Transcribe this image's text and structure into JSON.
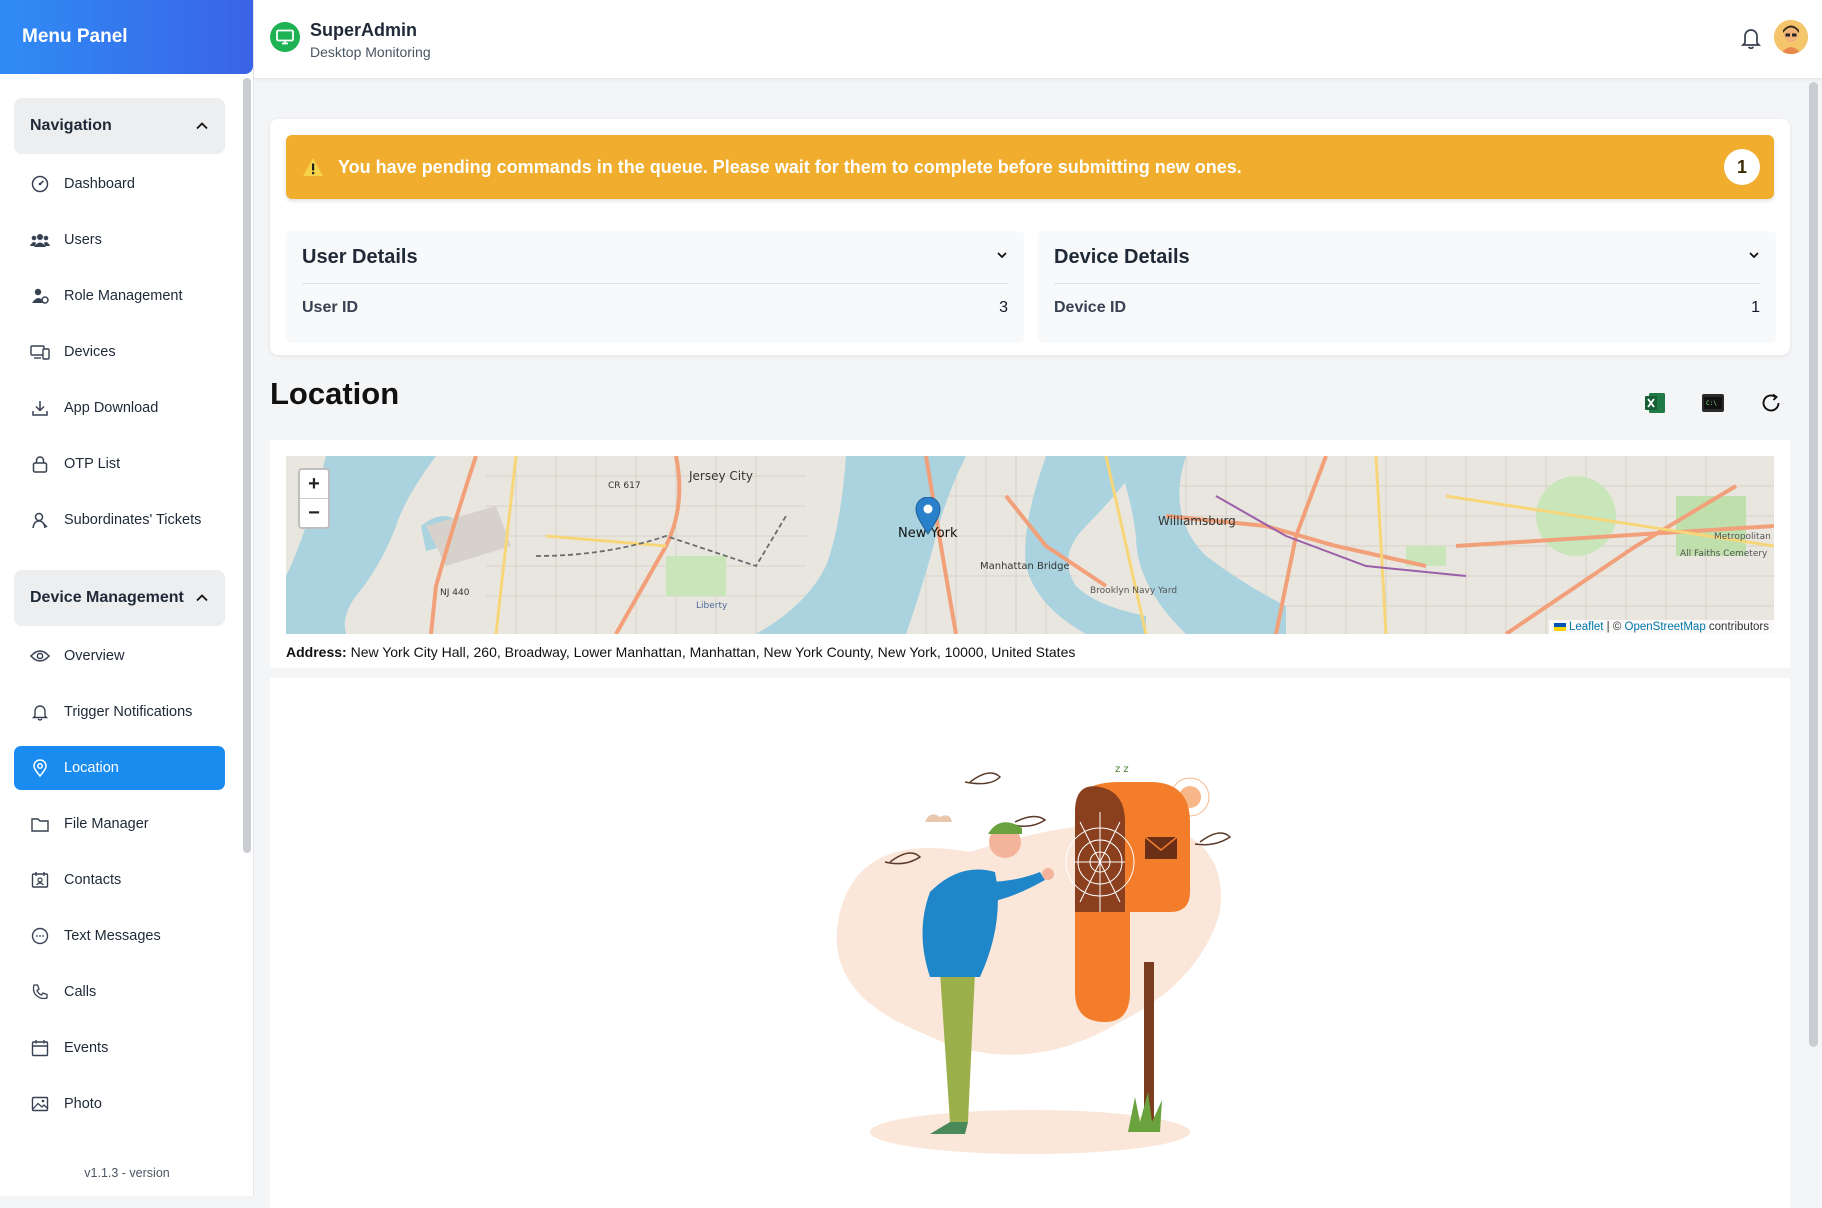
{
  "sidebar": {
    "title": "Menu Panel",
    "navigation": {
      "heading": "Navigation",
      "items": [
        {
          "label": "Dashboard",
          "icon": "dashboard-icon"
        },
        {
          "label": "Users",
          "icon": "users-icon"
        },
        {
          "label": "Role Management",
          "icon": "role-management-icon"
        },
        {
          "label": "Devices",
          "icon": "devices-icon"
        },
        {
          "label": "App Download",
          "icon": "download-icon"
        },
        {
          "label": "OTP List",
          "icon": "lock-icon"
        },
        {
          "label": "Subordinates' Tickets",
          "icon": "ticket-user-icon"
        }
      ]
    },
    "device_management": {
      "heading": "Device Management",
      "items": [
        {
          "label": "Overview",
          "icon": "eye-icon"
        },
        {
          "label": "Trigger Notifications",
          "icon": "bell-icon"
        },
        {
          "label": "Location",
          "icon": "location-pin-icon",
          "active": true
        },
        {
          "label": "File Manager",
          "icon": "folder-icon"
        },
        {
          "label": "Contacts",
          "icon": "contacts-icon"
        },
        {
          "label": "Text Messages",
          "icon": "message-icon"
        },
        {
          "label": "Calls",
          "icon": "phone-icon"
        },
        {
          "label": "Events",
          "icon": "calendar-icon"
        },
        {
          "label": "Photo",
          "icon": "image-icon"
        }
      ]
    },
    "version": "v1.1.3 - version"
  },
  "header": {
    "title": "SuperAdmin",
    "subtitle": "Desktop Monitoring"
  },
  "alert": {
    "message": "You have pending commands in the queue. Please wait for them to complete before submitting new ones.",
    "count": "1"
  },
  "user_details": {
    "title": "User Details",
    "label": "User ID",
    "value": "3"
  },
  "device_details": {
    "title": "Device Details",
    "label": "Device ID",
    "value": "1"
  },
  "location": {
    "title": "Location",
    "map_labels": {
      "jersey_city": "Jersey City",
      "new_york": "New York",
      "williamsburg": "Williamsburg",
      "manhattan_bridge": "Manhattan Bridge",
      "cr617": "CR 617",
      "nj440": "NJ 440",
      "liberty": "Liberty",
      "brooklyn_navy_yard": "Brooklyn Navy Yard",
      "all_faiths": "All Faiths Cemetery",
      "metropolitan": "Metropolitan"
    },
    "zoom_in": "+",
    "zoom_out": "−",
    "attribution": {
      "leaflet": "Leaflet",
      "sep": " | © ",
      "osm": "OpenStreetMap",
      "contributors": " contributors"
    },
    "address_label": "Address:",
    "address_value": "New York City Hall, 260, Broadway, Lower Manhattan, Manhattan, New York County, New York, 10000, United States"
  },
  "colors": {
    "accent": "#1a8cf0",
    "alert": "#f0ad2e",
    "brand_green": "#1fb254"
  }
}
